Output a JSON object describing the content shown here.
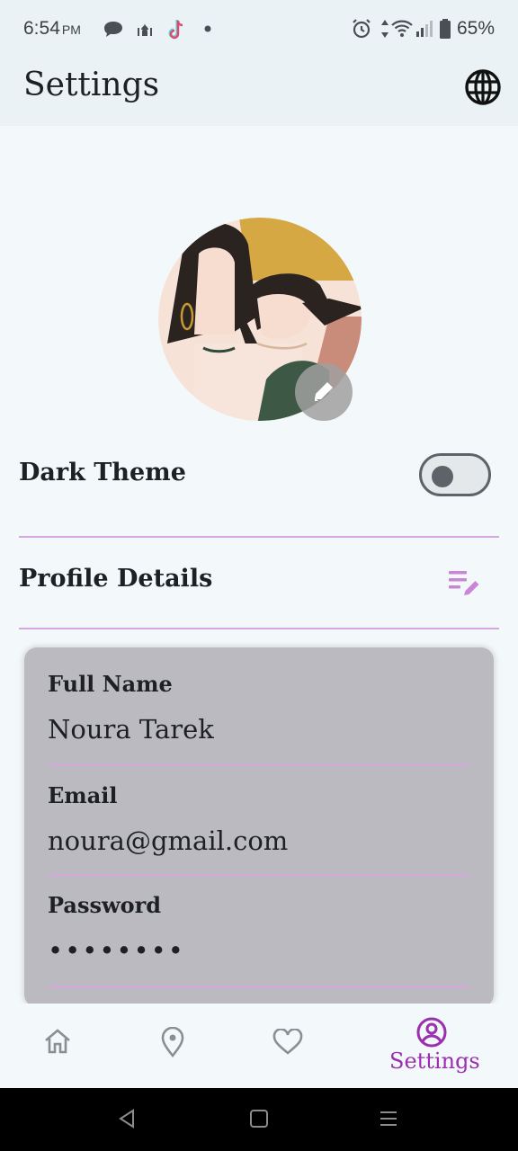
{
  "status_bar": {
    "time": "6:54",
    "ampm": "PM",
    "battery": "65%"
  },
  "app_bar": {
    "title": "Settings",
    "language_icon": "globe-icon"
  },
  "profile": {
    "avatar_icon": "avatar-illustration",
    "edit_icon": "pencil-icon"
  },
  "dark_theme": {
    "label": "Dark Theme",
    "enabled": false
  },
  "profile_details": {
    "label": "Profile Details",
    "edit_icon": "edit-list-icon"
  },
  "fields": [
    {
      "label": "Full Name",
      "value": "Noura Tarek"
    },
    {
      "label": "Email",
      "value": "noura@gmail.com"
    },
    {
      "label": "Password",
      "value": "••••••••"
    }
  ],
  "bottom_nav": {
    "items": [
      {
        "icon": "home-icon",
        "label": ""
      },
      {
        "icon": "location-pin-icon",
        "label": ""
      },
      {
        "icon": "heart-icon",
        "label": ""
      },
      {
        "icon": "account-circle-icon",
        "label": "Settings",
        "active": true
      }
    ]
  },
  "colors": {
    "accent": "#9a2fb0",
    "divider": "#d7a8e0",
    "card": "#bbbac1",
    "background": "#f3f9fa"
  }
}
